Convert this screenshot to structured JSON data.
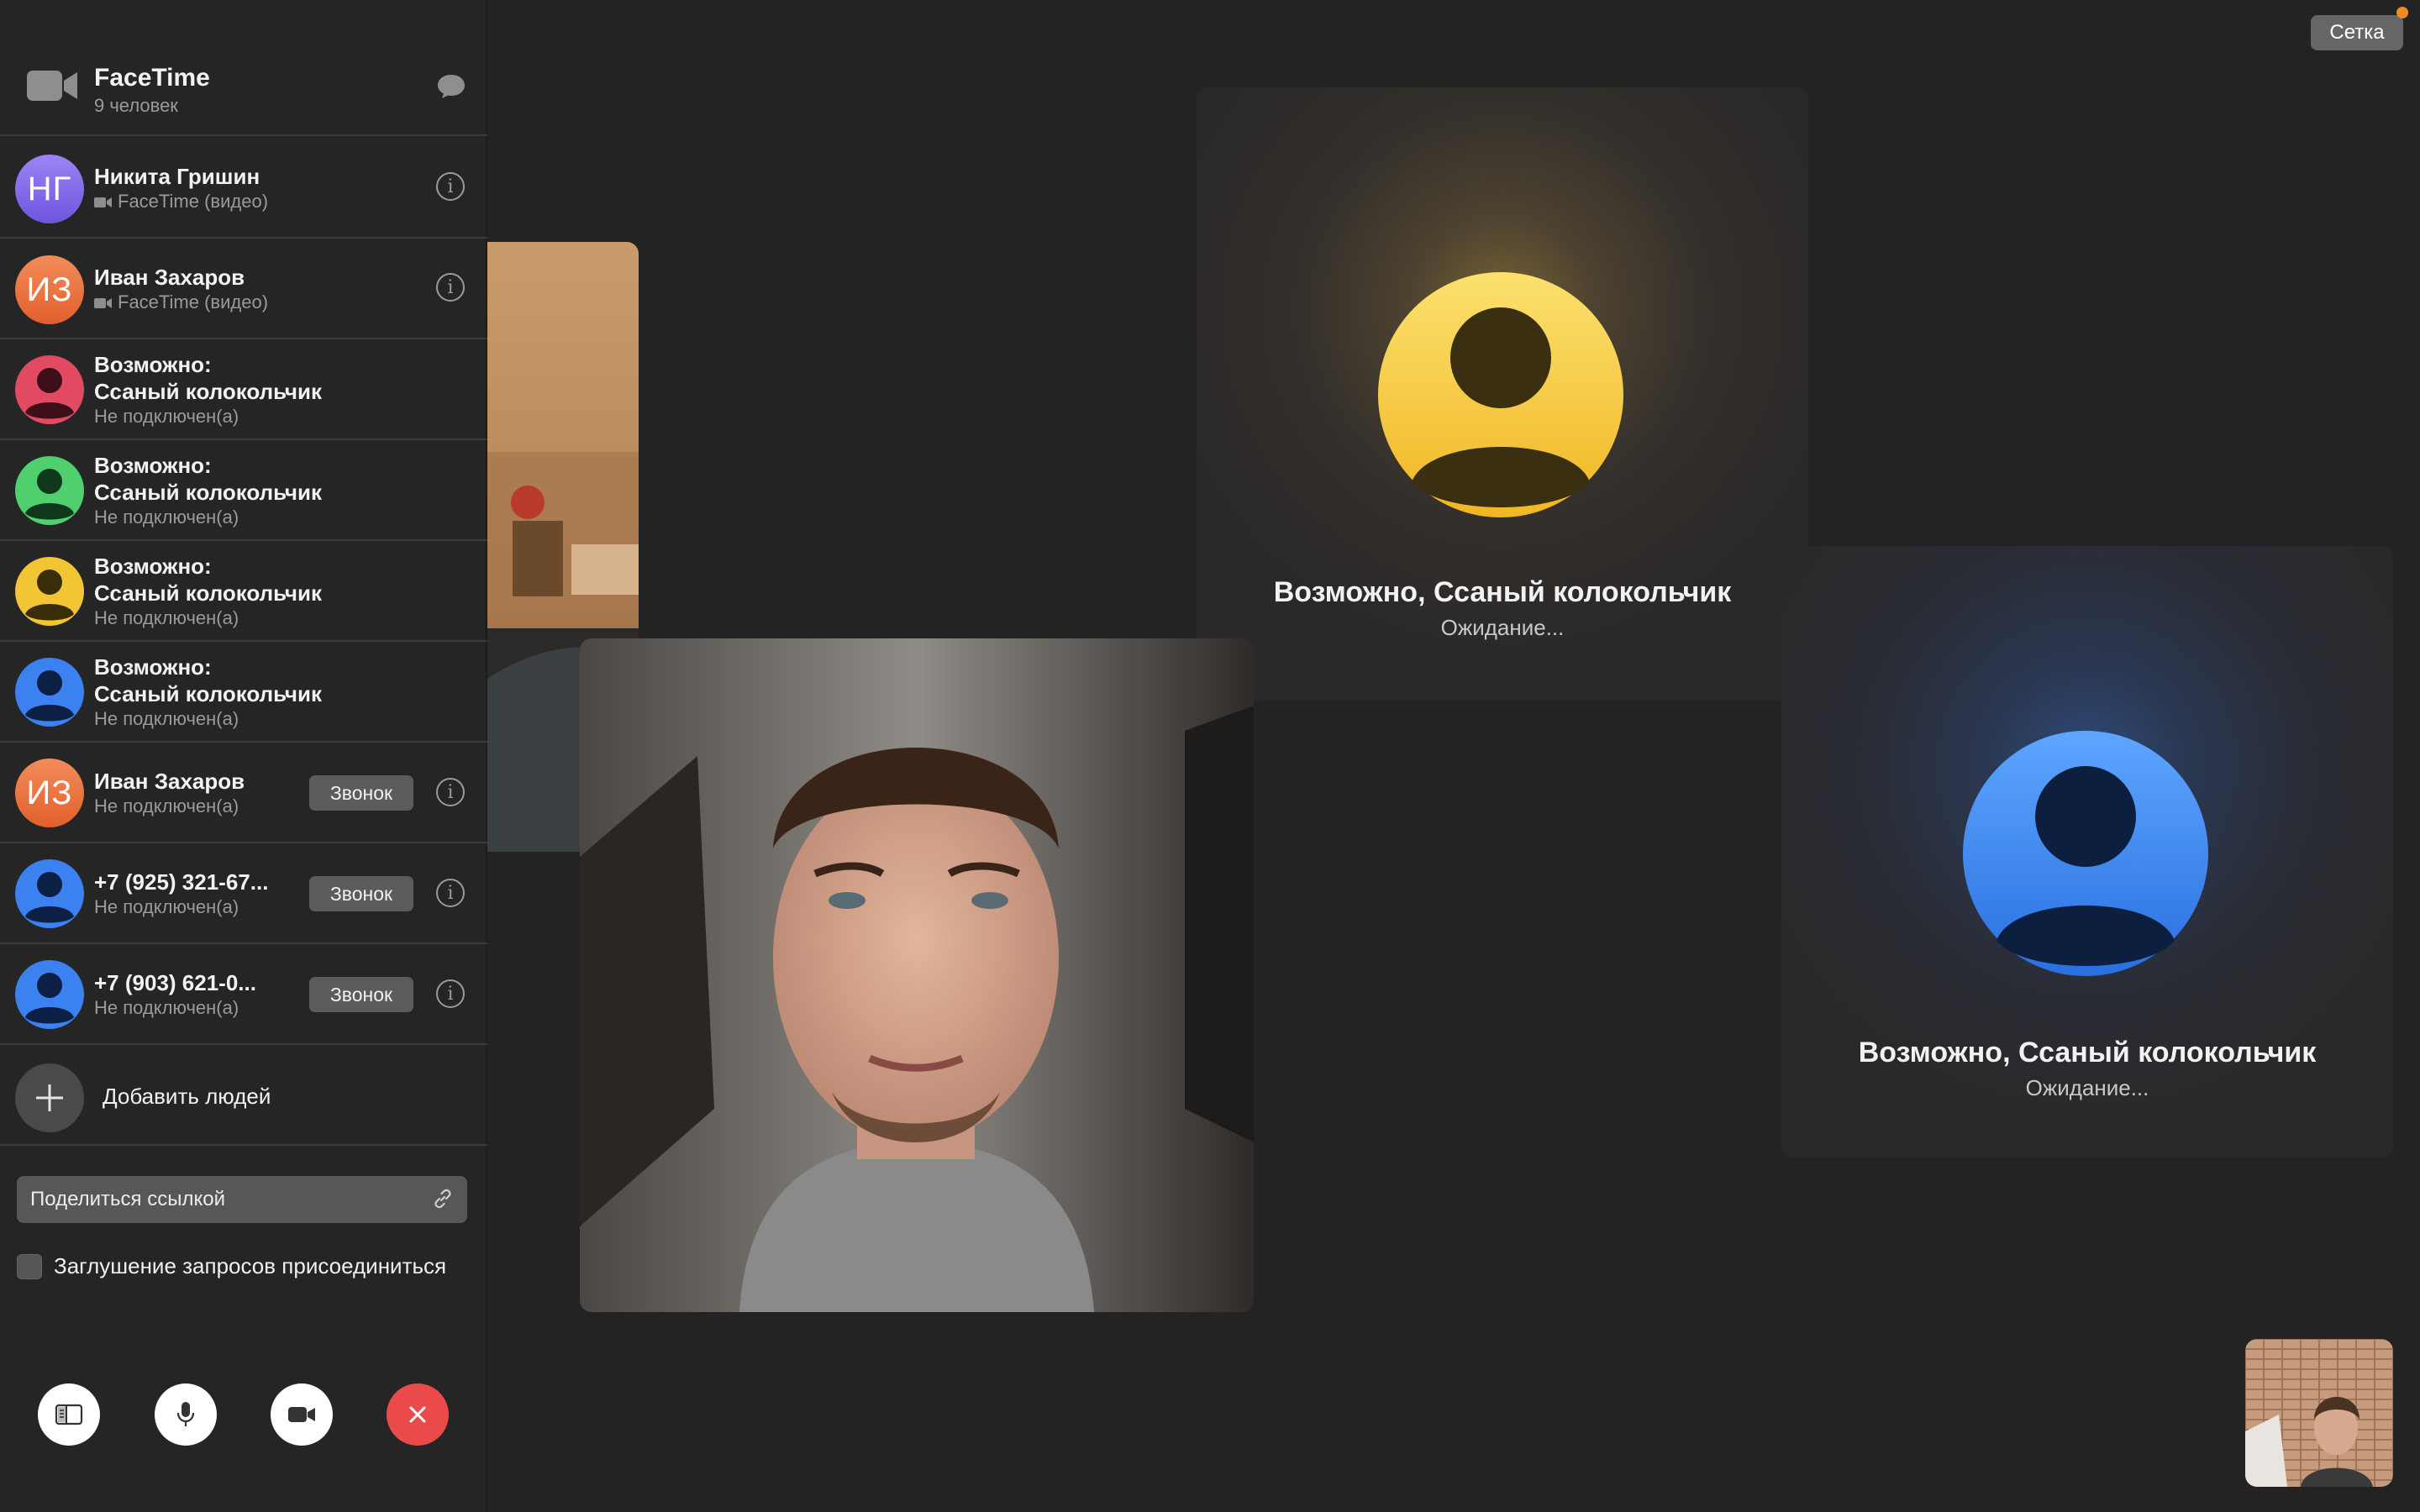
{
  "header": {
    "app_title": "FaceTime",
    "participant_count": "9 человек",
    "icons": {
      "app": "video-camera-icon",
      "messages": "message-bubble-icon"
    }
  },
  "participants": [
    {
      "initials": "НГ",
      "name": "Никита Гришин",
      "status": "FaceTime (видео)",
      "avatar_color": "#8a6cf0"
    },
    {
      "initials": "ИЗ",
      "name": "Иван Захаров",
      "status": "FaceTime (видео)",
      "avatar_color": "#ee7442"
    },
    {
      "name_line1": "Возможно:",
      "name_line2": "Ссаный колокольчик",
      "status": "Не подключен(а)",
      "avatar_color": "#e24a62"
    },
    {
      "name_line1": "Возможно:",
      "name_line2": "Ссаный колокольчик",
      "status": "Не подключен(а)",
      "avatar_color": "#4fcf6e"
    },
    {
      "name_line1": "Возможно:",
      "name_line2": "Ссаный колокольчик",
      "status": "Не подключен(а)",
      "avatar_color": "#f2c534"
    },
    {
      "name_line1": "Возможно:",
      "name_line2": "Ссаный колокольчик",
      "status": "Не подключен(а)",
      "avatar_color": "#3b82f0"
    },
    {
      "initials": "ИЗ",
      "name": "Иван Захаров",
      "status": "Не подключен(а)",
      "call_label": "Звонок",
      "avatar_color": "#ee7442"
    },
    {
      "name": "+7 (925) 321-67...",
      "status": "Не подключен(а)",
      "call_label": "Звонок",
      "avatar_color": "#3b82f0"
    },
    {
      "name": "+7 (903) 621-0...",
      "status": "Не подключен(а)",
      "call_label": "Звонок",
      "avatar_color": "#3b82f0"
    }
  ],
  "add_people": {
    "label": "Добавить людей"
  },
  "share": {
    "label": "Поделиться ссылкой"
  },
  "mute_requests": {
    "label": "Заглушение запросов присоединиться",
    "checked": false
  },
  "controls": [
    {
      "name": "sidebar-toggle",
      "icon": "sidebar-icon"
    },
    {
      "name": "microphone",
      "icon": "microphone-icon"
    },
    {
      "name": "camera",
      "icon": "video-camera-icon"
    },
    {
      "name": "end-call",
      "icon": "close-icon",
      "color": "#ea4a4a"
    }
  ],
  "grid_button": {
    "label": "Сетка"
  },
  "tiles": [
    {
      "name": "Возможно, Ссаный колокольчик",
      "status": "Ожидание...",
      "avatar_color": "#f7cf3a"
    },
    {
      "name": "Возможно, Ссаный колокольчик",
      "status": "Ожидание...",
      "avatar_color": "#3a86f0"
    }
  ]
}
